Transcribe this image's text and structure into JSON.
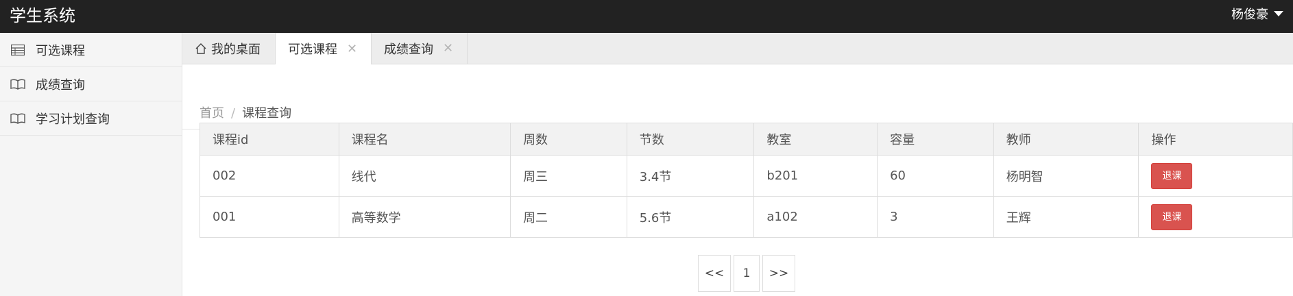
{
  "header": {
    "brand": "学生系统",
    "user": "杨俊豪"
  },
  "sidebar": {
    "items": [
      {
        "label": "可选课程",
        "icon": "table-list-icon"
      },
      {
        "label": "成绩查询",
        "icon": "book-icon"
      },
      {
        "label": "学习计划查询",
        "icon": "book-icon"
      }
    ]
  },
  "tabs": [
    {
      "label": "我的桌面",
      "icon": "home-icon",
      "closable": false,
      "active": false
    },
    {
      "label": "可选课程",
      "closable": true,
      "active": true
    },
    {
      "label": "成绩查询",
      "closable": true,
      "active": false
    }
  ],
  "tab_close_glyph": "✕",
  "breadcrumb": {
    "home": "首页",
    "separator": "/",
    "current": "课程查询"
  },
  "table": {
    "columns": [
      "课程id",
      "课程名",
      "周数",
      "节数",
      "教室",
      "容量",
      "教师",
      "操作"
    ],
    "rows": [
      {
        "id": "002",
        "name": "线代",
        "week": "周三",
        "section": "3.4节",
        "room": "b201",
        "capacity": "60",
        "teacher": "杨明智",
        "action": "退课"
      },
      {
        "id": "001",
        "name": "高等数学",
        "week": "周二",
        "section": "5.6节",
        "room": "a102",
        "capacity": "3",
        "teacher": "王辉",
        "action": "退课"
      }
    ]
  },
  "pagination": {
    "prev": "<<",
    "page": "1",
    "next": ">>"
  },
  "colors": {
    "topbar": "#222222",
    "danger": "#d9534f",
    "sidebar": "#f5f5f5",
    "tabbar": "#ededed"
  }
}
